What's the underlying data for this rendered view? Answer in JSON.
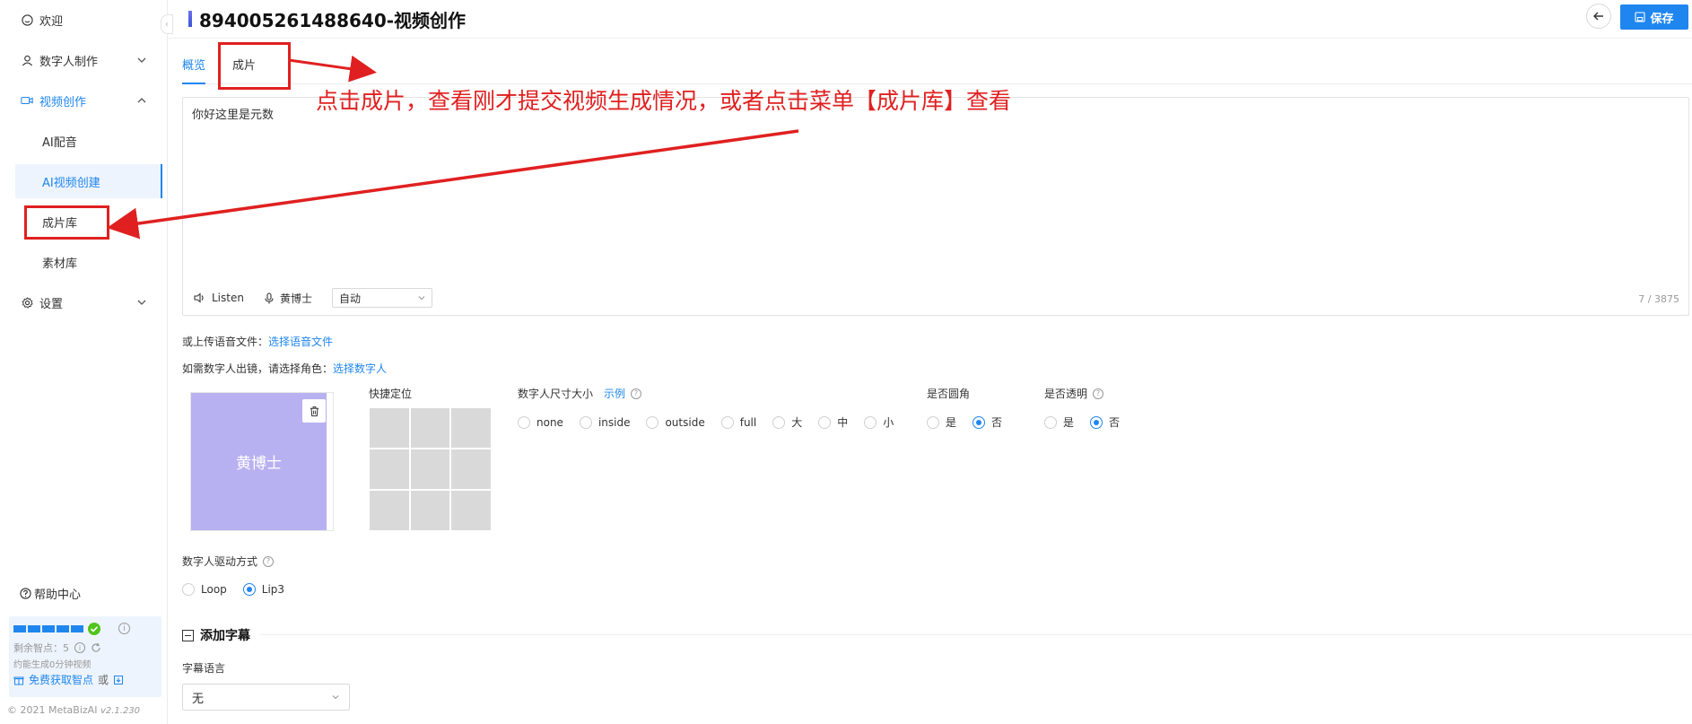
{
  "sidebar": {
    "items": [
      {
        "label": "欢迎",
        "icon": "smile-icon"
      },
      {
        "label": "数字人制作",
        "icon": "user-icon"
      },
      {
        "label": "视频创作",
        "icon": "video-icon"
      },
      {
        "label": "设置",
        "icon": "gear-icon"
      }
    ],
    "sub_items": [
      "AI配音",
      "AI视频创建",
      "成片库",
      "素材库"
    ],
    "help": "帮助中心",
    "points": {
      "remaining": "剩余智点：5",
      "estimate": "约能生成0分钟视频",
      "free_link": "免费获取智点",
      "or": "或"
    },
    "copyright": "© 2021 MetaBizAI",
    "version": "v2.1.230"
  },
  "header": {
    "title": "894005261488640-视频创作",
    "save_label": "保存"
  },
  "tabs": [
    "概览",
    "成片"
  ],
  "editor": {
    "text": "你好这里是元数",
    "listen": "Listen",
    "voice": "黄博士",
    "speed_value": "自动",
    "counter": "7 / 3875"
  },
  "form": {
    "upload_prefix": "或上传语音文件：",
    "upload_link": "选择语音文件",
    "role_prefix": "如需数字人出镜，请选择角色：",
    "role_link": "选择数字人",
    "avatar_name": "黄博士",
    "quick_position": "快捷定位",
    "size_label": "数字人尺寸大小",
    "size_example": "示例",
    "size_options": [
      "none",
      "inside",
      "outside",
      "full",
      "大",
      "中",
      "小"
    ],
    "corner_label": "是否圆角",
    "corner_options": [
      "是",
      "否"
    ],
    "transparent_label": "是否透明",
    "transparent_options": [
      "是",
      "否"
    ],
    "drive_label": "数字人驱动方式",
    "drive_options": [
      "Loop",
      "Lip3"
    ],
    "subtitle_header": "添加字幕",
    "subtitle_lang_label": "字幕语言",
    "subtitle_lang_value": "无"
  },
  "annotation": {
    "text": "点击成片，查看刚才提交视频生成情况，或者点击菜单【成片库】查看"
  },
  "colors": {
    "accent": "#1f86f0",
    "annotation": "#e02020",
    "avatar_bg": "#b7b1f1"
  }
}
